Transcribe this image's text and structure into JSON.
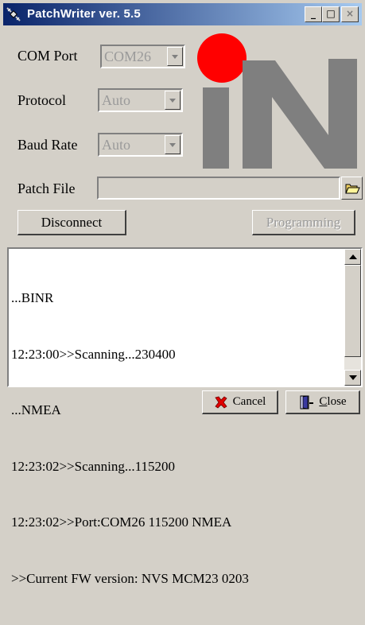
{
  "window": {
    "title": "PatchWriter ver. 5.5",
    "controls": {
      "minimize": "_",
      "maximize": "□",
      "close": "×"
    }
  },
  "settings": {
    "com_port": {
      "label": "COM Port",
      "value": "COM26"
    },
    "protocol": {
      "label": "Protocol",
      "value": "Auto"
    },
    "baud_rate": {
      "label": "Baud Rate",
      "value": "Auto"
    },
    "patch_file": {
      "label": "Patch File",
      "value": ""
    }
  },
  "buttons": {
    "disconnect": "Disconnect",
    "programming": "Programming",
    "cancel": "Cancel",
    "close_first": "C",
    "close_rest": "lose"
  },
  "log": [
    "...BINR",
    "12:23:00>>Scanning...230400",
    "...NMEA",
    "12:23:02>>Scanning...115200",
    "12:23:02>>Port:COM26 115200 NMEA",
    ">>Current FW version: NVS MCM23 0203"
  ],
  "colors": {
    "logo_red": "#ff0000",
    "logo_gray": "#7f7f7f",
    "title_bar": "#0a246a",
    "disabled_text": "#9a9a9a"
  },
  "icons": {
    "app": "satellite-icon",
    "folder": "folder-open-icon",
    "cancel": "red-x-icon",
    "close": "door-icon"
  }
}
